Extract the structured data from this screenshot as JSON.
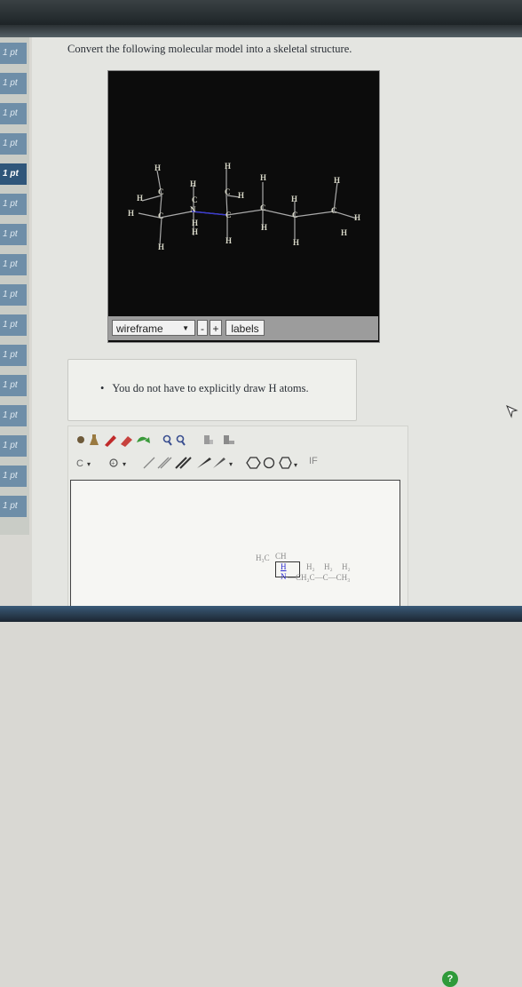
{
  "question": {
    "text": "Convert the following molecular model into a skeletal structure."
  },
  "sidebar": {
    "items": [
      {
        "label": "1 pt",
        "active": false
      },
      {
        "label": "1 pt",
        "active": false
      },
      {
        "label": "1 pt",
        "active": false
      },
      {
        "label": "1 pt",
        "active": false
      },
      {
        "label": "1 pt",
        "active": true
      },
      {
        "label": "1 pt",
        "active": false
      },
      {
        "label": "1 pt",
        "active": false
      },
      {
        "label": "1 pt",
        "active": false
      },
      {
        "label": "1 pt",
        "active": false
      },
      {
        "label": "1 pt",
        "active": false
      },
      {
        "label": "1 pt",
        "active": false
      },
      {
        "label": "1 pt",
        "active": false
      },
      {
        "label": "1 pt",
        "active": false
      },
      {
        "label": "1 pt",
        "active": false
      },
      {
        "label": "1 pt",
        "active": false
      },
      {
        "label": "1 pt",
        "active": false
      }
    ]
  },
  "viewer": {
    "mode_select": "wireframe",
    "zoom_out": "-",
    "zoom_in": "+",
    "labels_button": "labels",
    "atom_labels": {
      "h": "H",
      "c": "C",
      "n": "N"
    }
  },
  "hint": {
    "bullet": "•",
    "text": "You do not have to explicitly draw H atoms."
  },
  "toolbar": {
    "row1_icons": [
      "hand-icon",
      "flask-icon",
      "pencil-icon",
      "eraser-icon",
      "rotate-icon",
      "zoom-in-icon",
      "zoom-out-icon",
      "clean-icon",
      "template-icon"
    ],
    "row2_icons": [
      "element-dropdown",
      "charge-dropdown",
      "single-bond-icon",
      "double-bond-icon",
      "triple-bond-icon",
      "wedge-bond-icon",
      "ring-dropdown",
      "text-tool"
    ],
    "text_tool_label": "IF"
  },
  "canvas": {
    "help_label": "?",
    "skeleton": {
      "h3c": "H₃C",
      "ch": "CH",
      "h": "H",
      "n": "N",
      "chain": "—CH₂C—C—CH₃",
      "h2a": "H₂",
      "h2b": "H₂",
      "h2c": "H₂"
    }
  }
}
